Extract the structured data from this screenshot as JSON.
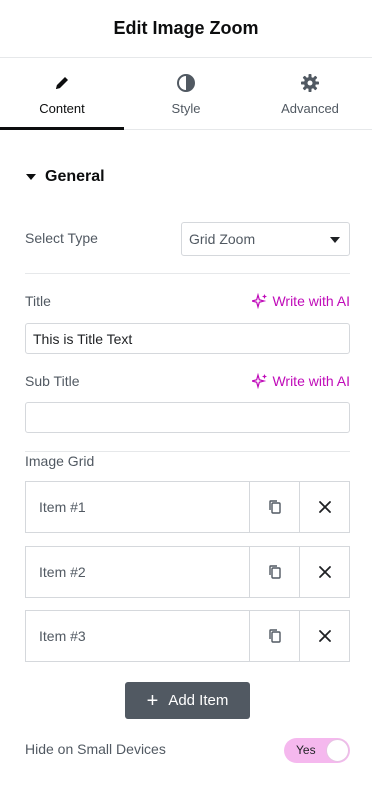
{
  "header": {
    "title": "Edit Image Zoom"
  },
  "tabs": [
    {
      "label": "Content",
      "icon": "pencil-icon",
      "active": true
    },
    {
      "label": "Style",
      "icon": "contrast-icon",
      "active": false
    },
    {
      "label": "Advanced",
      "icon": "gear-icon",
      "active": false
    }
  ],
  "section": {
    "title": "General",
    "expanded": true
  },
  "controls": {
    "select_type": {
      "label": "Select Type",
      "value": "Grid Zoom"
    },
    "title": {
      "label": "Title",
      "value": "This is Title Text",
      "ai_label": "Write with AI"
    },
    "sub_title": {
      "label": "Sub Title",
      "value": "",
      "ai_label": "Write with AI"
    },
    "image_grid": {
      "label": "Image Grid",
      "items": [
        {
          "title": "Item #1"
        },
        {
          "title": "Item #2"
        },
        {
          "title": "Item #3"
        }
      ],
      "add_label": "Add Item"
    },
    "hide_small": {
      "label": "Hide on Small Devices",
      "toggle_text": "Yes",
      "on": true
    }
  },
  "colors": {
    "accent_ai": "#c00bb9",
    "toggle_on": "#f5b8ee",
    "button_dark": "#515962"
  }
}
